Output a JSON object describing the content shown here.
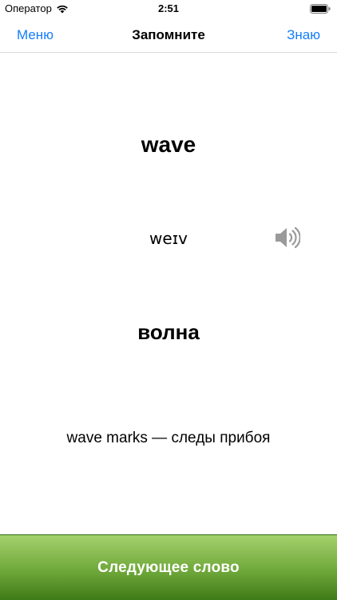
{
  "status_bar": {
    "carrier": "Оператор",
    "time": "2:51"
  },
  "nav": {
    "left_label": "Меню",
    "title": "Запомните",
    "right_label": "Знаю"
  },
  "card": {
    "word": "wave",
    "transcription": "weɪv",
    "translation": "волна",
    "example": "wave marks — следы прибоя"
  },
  "footer": {
    "next_label": "Следующее слово"
  },
  "icons": {
    "wifi": "wifi-icon",
    "battery": "battery-icon",
    "speaker": "speaker-icon"
  },
  "colors": {
    "accent": "#147efb",
    "button_top": "#a4d16c",
    "button_bottom": "#3e7a17",
    "speaker": "#9a9a9a"
  }
}
